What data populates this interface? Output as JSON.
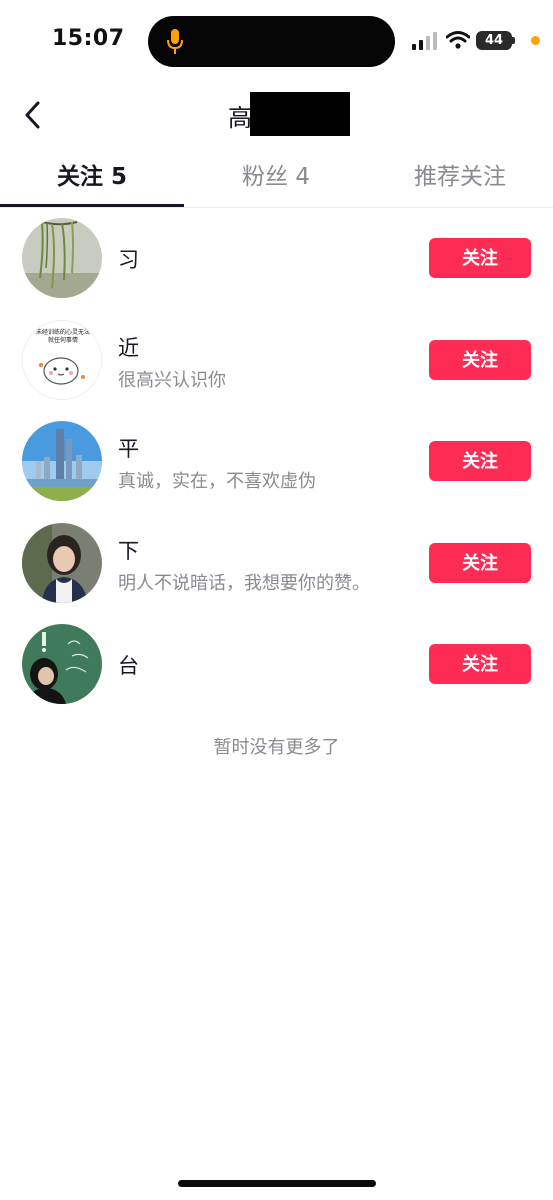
{
  "status_bar": {
    "time": "15:07",
    "battery": "44",
    "icons": [
      "mic-icon",
      "signal-icon",
      "wifi-icon",
      "battery-icon"
    ],
    "accent_colors": {
      "mic": "#ff9f0a",
      "privacy_dot": "#ff9f0a"
    }
  },
  "header": {
    "title": "高",
    "back_icon": "chevron-left-icon"
  },
  "tabs": [
    {
      "label": "关注 5",
      "active": true
    },
    {
      "label": "粉丝 4",
      "active": false
    },
    {
      "label": "推荐关注",
      "active": false
    }
  ],
  "list": {
    "items": [
      {
        "name": "习",
        "bio": "",
        "button": "关注",
        "avatar": "willow-tree-avatar"
      },
      {
        "name": "近",
        "bio": "很高兴认识你",
        "button": "关注",
        "avatar": "cartoon-meme-avatar",
        "avatar_caption": [
          "未经训练的心灵无法",
          "就任何事情"
        ]
      },
      {
        "name": "平",
        "bio": "真诚，实在，不喜欢虚伪",
        "button": "关注",
        "avatar": "city-skyline-avatar"
      },
      {
        "name": "下",
        "bio": "明人不说暗话，我想要你的赞。",
        "button": "关注",
        "avatar": "person-photo-avatar"
      },
      {
        "name": "台",
        "bio": "",
        "button": "关注",
        "avatar": "chalkboard-avatar"
      }
    ]
  },
  "footer": {
    "end_text": "暂时没有更多了"
  },
  "colors": {
    "follow_button": "#fe2c55",
    "primary_text": "#161823",
    "secondary_text": "#8a8b91"
  }
}
